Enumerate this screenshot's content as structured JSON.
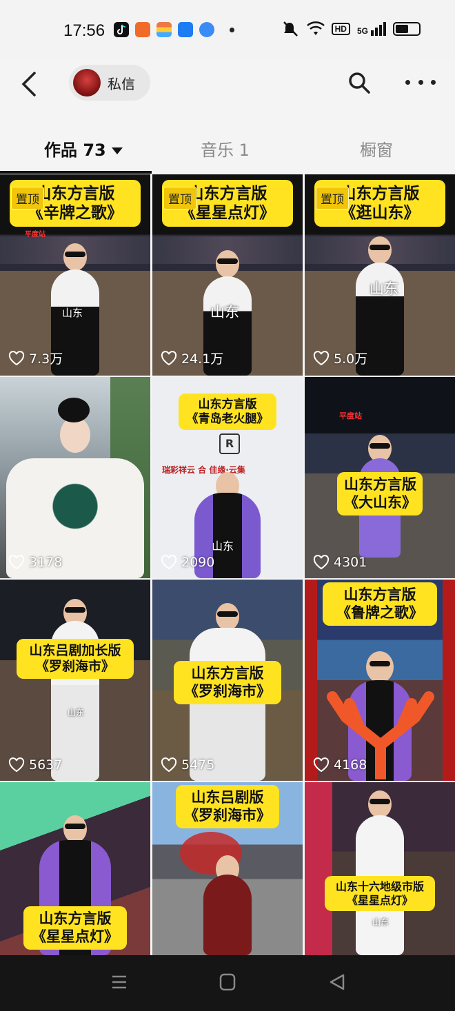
{
  "status": {
    "time": "17:56",
    "apps": [
      {
        "name": "tiktok-app-icon",
        "color": "#111111"
      },
      {
        "name": "app-icon-orange",
        "color": "#f06a2a"
      },
      {
        "name": "app-icon-stripes",
        "color": "#e8b73a"
      },
      {
        "name": "app-icon-blue",
        "color": "#1d7cf2"
      },
      {
        "name": "app-icon-feather",
        "color": "#3a8bf5"
      }
    ],
    "hd": "HD",
    "network": "5G"
  },
  "nav": {
    "pm_label": "私信"
  },
  "tabs": [
    {
      "label": "作品 73"
    },
    {
      "label": "音乐 1"
    },
    {
      "label": "橱窗"
    }
  ],
  "pinned_label": "置顶",
  "videos": [
    {
      "title1": "山东方言版",
      "title2": "《辛牌之歌》",
      "pinned": true,
      "likes": "7.3万",
      "loc": "山东"
    },
    {
      "title1": "山东方言版",
      "title2": "《星星点灯》",
      "pinned": true,
      "likes": "24.1万",
      "loc": "山东"
    },
    {
      "title1": "山东方言版",
      "title2": "《逛山东》",
      "pinned": true,
      "likes": "5.0万",
      "loc": "山东"
    },
    {
      "title1": "",
      "title2": "",
      "pinned": false,
      "likes": "3178",
      "loc": ""
    },
    {
      "title1": "山东方言版",
      "title2": "《青岛老火腿》",
      "pinned": false,
      "likes": "2090",
      "loc": "山东"
    },
    {
      "title1": "山东方言版",
      "title2": "《大山东》",
      "pinned": false,
      "likes": "4301",
      "loc": ""
    },
    {
      "title1": "山东吕剧加长版",
      "title2": "《罗刹海市》",
      "pinned": false,
      "likes": "5637",
      "loc": "山东"
    },
    {
      "title1": "山东方言版",
      "title2": "《罗刹海市》",
      "pinned": false,
      "likes": "5475",
      "loc": ""
    },
    {
      "title1": "山东方言版",
      "title2": "《鲁牌之歌》",
      "pinned": false,
      "likes": "4168",
      "loc": ""
    },
    {
      "title1": "山东方言版",
      "title2": "《星星点灯》",
      "pinned": false,
      "likes": "",
      "loc": ""
    },
    {
      "title1": "山东吕剧版",
      "title2": "《罗刹海市》",
      "pinned": false,
      "likes": "",
      "loc": ""
    },
    {
      "title1": "山东十六地级市版",
      "title2": "《星星点灯》",
      "pinned": false,
      "likes": "",
      "loc": "山东"
    }
  ],
  "station_sign": "平度站",
  "banner_text": "瑞彩祥云 合 佳缘·云集"
}
